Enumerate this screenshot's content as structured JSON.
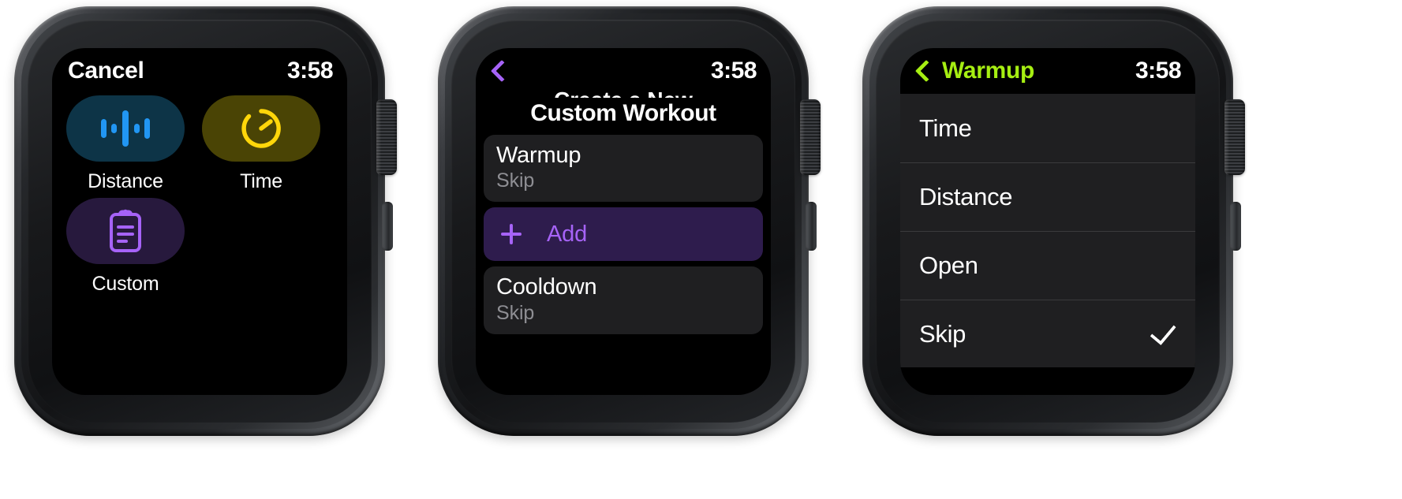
{
  "colors": {
    "accent_purple": "#a663f7",
    "accent_green": "#a6ee12",
    "distance_tile_bg": "#0d3447",
    "distance_icon": "#2196f3",
    "time_tile_bg": "#4a4405",
    "time_icon": "#ffd60a",
    "custom_tile_bg": "#27193d",
    "custom_icon": "#a663f7",
    "card_bg": "#1f1f21",
    "add_row_bg": "#2e1c4d",
    "subtitle_gray": "#8e8e93",
    "screen_bg": "#000000"
  },
  "watch1": {
    "nav": {
      "cancel_label": "Cancel",
      "clock": "3:58"
    },
    "tiles": [
      {
        "label": "Distance",
        "icon": "waveform-icon"
      },
      {
        "label": "Time",
        "icon": "timer-icon"
      },
      {
        "label": "Custom",
        "icon": "clipboard-icon"
      }
    ]
  },
  "watch2": {
    "nav": {
      "back_icon": "chevron-left-icon",
      "clock": "3:58"
    },
    "scrolled_title": "Create a New",
    "title": "Custom Workout",
    "rows": [
      {
        "title": "Warmup",
        "subtitle": "Skip"
      }
    ],
    "add_row": {
      "icon": "plus-icon",
      "label": "Add"
    },
    "rows_after": [
      {
        "title": "Cooldown",
        "subtitle": "Skip"
      }
    ]
  },
  "watch3": {
    "nav": {
      "back_icon": "chevron-left-icon",
      "back_label": "Warmup",
      "clock": "3:58"
    },
    "options": [
      {
        "label": "Time",
        "selected": false
      },
      {
        "label": "Distance",
        "selected": false
      },
      {
        "label": "Open",
        "selected": false
      },
      {
        "label": "Skip",
        "selected": true
      }
    ]
  }
}
